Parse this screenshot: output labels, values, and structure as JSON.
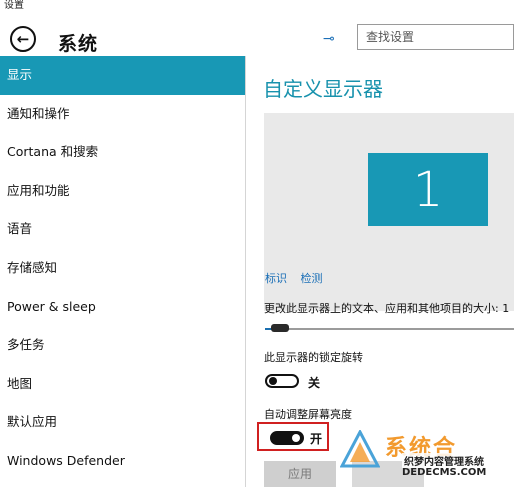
{
  "window": {
    "title": "设置"
  },
  "header": {
    "back_icon": "back-arrow-icon",
    "title": "系统",
    "pin_icon": "pin-icon",
    "search": {
      "placeholder": "查找设置"
    }
  },
  "sidebar": {
    "items": [
      {
        "label": "显示",
        "active": true
      },
      {
        "label": "通知和操作"
      },
      {
        "label": "Cortana 和搜索"
      },
      {
        "label": "应用和功能"
      },
      {
        "label": "语音"
      },
      {
        "label": "存储感知"
      },
      {
        "label": "Power & sleep"
      },
      {
        "label": "多任务"
      },
      {
        "label": "地图"
      },
      {
        "label": "默认应用"
      },
      {
        "label": "Windows Defender"
      }
    ]
  },
  "main": {
    "title": "自定义显示器",
    "monitor_number": "1",
    "links": {
      "identify": "标识",
      "detect": "检测"
    },
    "scale": {
      "label": "更改此显示器上的文本、应用和其他项目的大小: 1",
      "value_fraction": 0.06
    },
    "orientation_lock": {
      "label": "此显示器的锁定旋转",
      "state": "关"
    },
    "auto_brightness": {
      "label": "自动调整屏幕亮度",
      "state": "开"
    },
    "apply_label": "应用"
  },
  "watermark": {
    "brand": "系统合",
    "line1": "织梦内容管理系统",
    "line2": "DEDECMS.COM"
  },
  "colors": {
    "accent": "#1898b5",
    "link": "#1b6fb7",
    "highlight_border": "#d02020"
  }
}
